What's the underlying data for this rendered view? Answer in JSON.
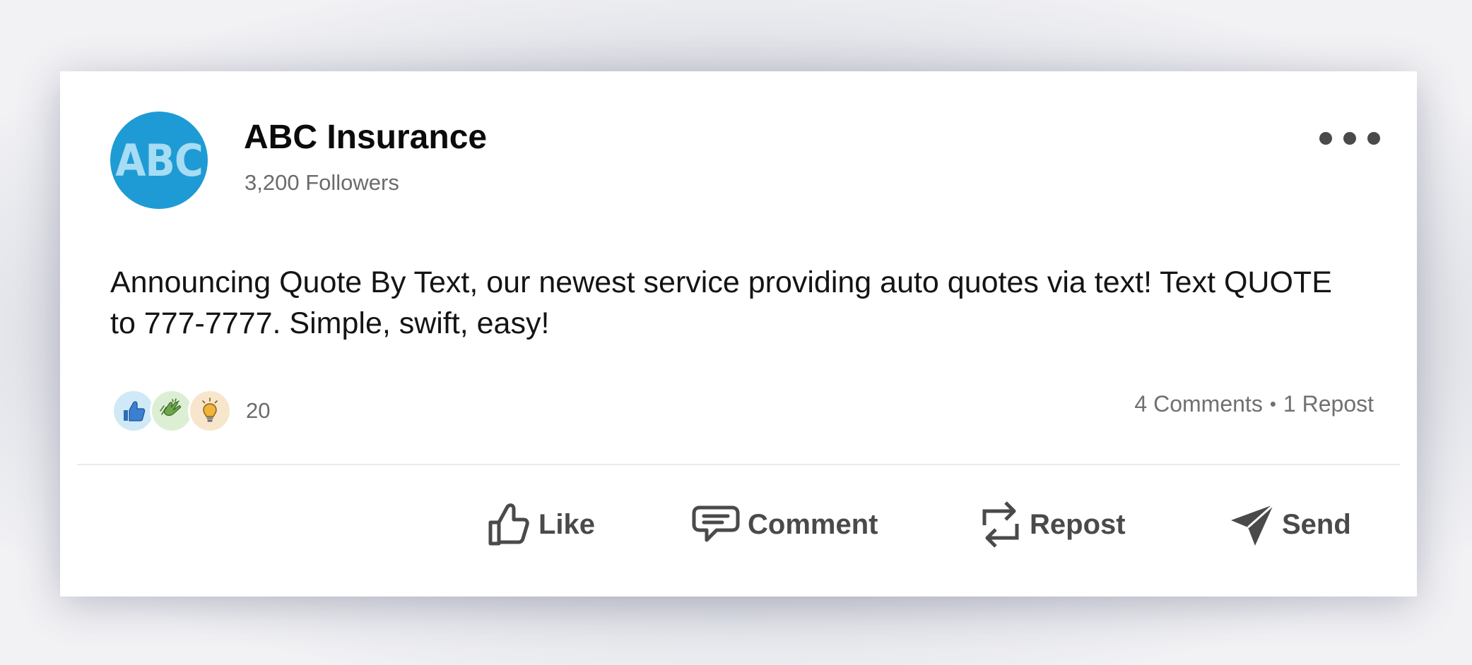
{
  "post": {
    "author": {
      "avatar_text": "ABC",
      "name": "ABC Insurance",
      "followers": "3,200 Followers"
    },
    "text": "Announcing Quote By Text, our newest service providing auto quotes via text! Text QUOTE to 777-7777. Simple, swift, easy!",
    "reactions": {
      "icons": [
        "thumbs-up-icon",
        "clapping-hands-icon",
        "lightbulb-icon"
      ],
      "count": "20"
    },
    "stats": {
      "comments": "4 Comments",
      "separator": "•",
      "reposts": "1 Repost"
    },
    "actions": {
      "like": "Like",
      "comment": "Comment",
      "repost": "Repost",
      "send": "Send"
    }
  },
  "colors": {
    "avatar_bg": "#1e9bd4",
    "avatar_text": "#a6dcf4",
    "action_text": "#4a4a4a"
  }
}
